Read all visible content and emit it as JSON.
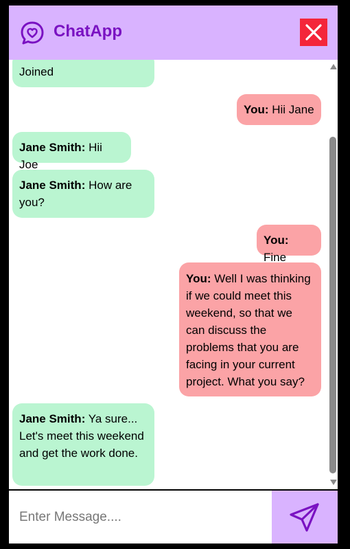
{
  "app": {
    "title": "ChatApp",
    "accent": "#7a12c2",
    "header_bg": "#d9b3ff",
    "close_bg": "#f4263a",
    "logo_icon": "heart-chat-icon",
    "close_icon": "close-icon"
  },
  "messages": [
    {
      "side": "left",
      "sender": "",
      "text": "Joined"
    },
    {
      "side": "right",
      "sender": "You:",
      "text": " Hii Jane"
    },
    {
      "side": "left",
      "sender": "Jane Smith:",
      "text": " Hii Joe"
    },
    {
      "side": "left",
      "sender": "Jane Smith:",
      "text": " How are you?"
    },
    {
      "side": "right",
      "sender": "You:",
      "text": " Fine"
    },
    {
      "side": "right",
      "sender": "You:",
      "text": " Well I was thinking if we could meet this weekend, so that we can discuss the problems that you are facing in your current project. What you say?"
    },
    {
      "side": "left",
      "sender": "Jane Smith:",
      "text": " Ya sure... Let's meet this weekend and get the work done."
    }
  ],
  "composer": {
    "placeholder": "Enter Message....",
    "value": "",
    "send_icon": "send-icon"
  },
  "colors": {
    "incoming_bubble": "#baf5d1",
    "outgoing_bubble": "#fba3a6"
  }
}
